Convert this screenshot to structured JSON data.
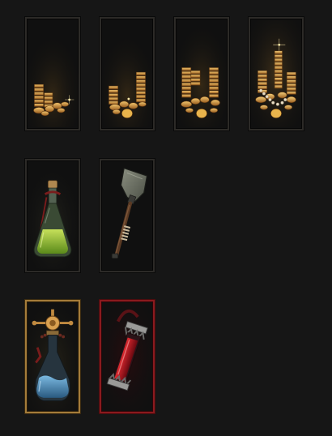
{
  "inventory": {
    "rows": [
      {
        "items": [
          {
            "icon": "gold-pile-small-icon",
            "tier": "common"
          },
          {
            "icon": "gold-pile-medium-icon",
            "tier": "common"
          },
          {
            "icon": "gold-pile-large-icon",
            "tier": "common"
          },
          {
            "icon": "gold-pile-huge-icon",
            "tier": "common"
          }
        ]
      },
      {
        "items": [
          {
            "icon": "green-potion-icon",
            "tier": "common"
          },
          {
            "icon": "shovel-icon",
            "tier": "common"
          }
        ]
      },
      {
        "items": [
          {
            "icon": "blue-flask-icon",
            "tier": "rare"
          },
          {
            "icon": "blood-vial-icon",
            "tier": "cursed"
          }
        ]
      }
    ]
  },
  "colors": {
    "background": "#161616",
    "slot_fill": "#101010",
    "slot_border": "#2c2a27",
    "rare_border": "#a47c3a",
    "cursed_border": "#8a1a1e",
    "gold": "#d49a4a",
    "potion_green": "#8cc43a",
    "flask_blue": "#4a8ab8",
    "blood_red": "#b0141c"
  }
}
